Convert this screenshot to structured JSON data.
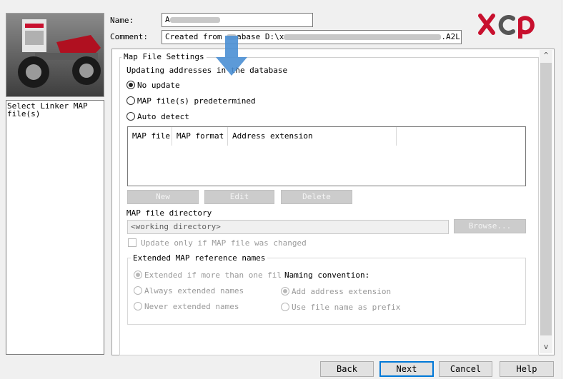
{
  "header": {
    "name_label": "Name:",
    "name_value": "A",
    "comment_label": "Comment:",
    "comment_prefix": "Created from ",
    "comment_mid": "abase D:\\x",
    "comment_suffix": ".A2L"
  },
  "logo": {
    "text": "xcp",
    "colors": [
      "#c8102e",
      "#555555"
    ]
  },
  "sidebar": {
    "step_label": "Select Linker MAP file(s)"
  },
  "map_settings": {
    "group_title": "Map File Settings",
    "updating_label": "Updating addresses in the database",
    "radios": [
      {
        "label": "No update",
        "checked": true
      },
      {
        "label": "MAP file(s) predetermined",
        "checked": false
      },
      {
        "label": "Auto detect",
        "checked": false
      }
    ],
    "table_columns": [
      "MAP file",
      "MAP format",
      "Address extension"
    ],
    "buttons": {
      "new": "New",
      "edit": "Edit",
      "delete": "Delete"
    },
    "dir_label": "MAP file directory",
    "dir_value": "<working directory>",
    "browse": "Browse...",
    "update_only_label": "Update only if MAP file was changed",
    "ext_group_title": "Extended MAP reference names",
    "ext_options": [
      {
        "label": "Extended if more than one fil",
        "checked": true
      },
      {
        "label": "Always extended names",
        "checked": false
      },
      {
        "label": "Never extended names",
        "checked": false
      }
    ],
    "naming_label": "Naming convention:",
    "naming_options": [
      {
        "label": "Add address extension",
        "checked": true
      },
      {
        "label": "Use file name as prefix",
        "checked": false
      }
    ]
  },
  "scroll": {
    "up": "^",
    "down": "v"
  },
  "footer": {
    "back": "Back",
    "next": "Next",
    "cancel": "Cancel",
    "help": "Help"
  },
  "colors": {
    "accent": "#0078d7",
    "arrow": "#4a8fd4",
    "logo_red": "#c8102e"
  }
}
